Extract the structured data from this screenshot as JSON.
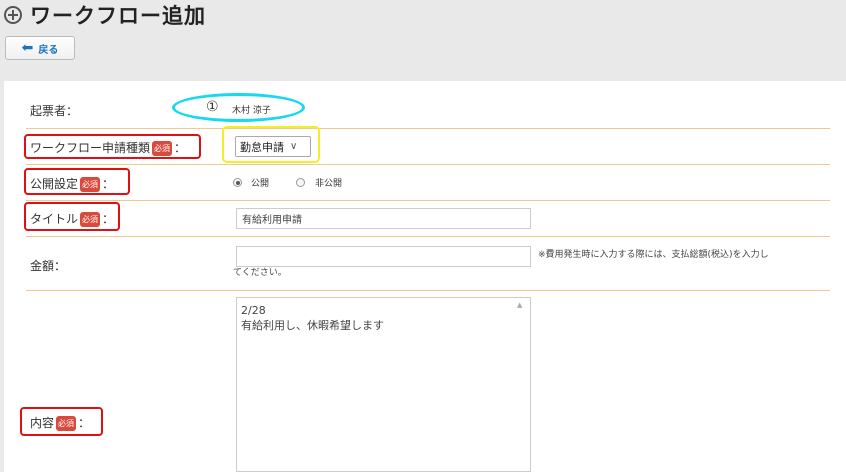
{
  "header": {
    "title": "ワークフロー追加",
    "back_label": "戻る"
  },
  "form": {
    "author": {
      "label": "起票者：",
      "marker": "①",
      "value": "木村 涼子"
    },
    "type": {
      "label": "ワークフロー申請種類",
      "required": "必須",
      "colon": "：",
      "selected": "勤怠申請"
    },
    "visibility": {
      "label": "公開設定",
      "required": "必須",
      "colon": "：",
      "options": [
        "公開",
        "非公開"
      ],
      "selected": "公開"
    },
    "title_field": {
      "label": "タイトル",
      "required": "必須",
      "colon": "：",
      "value": "有給利用申請"
    },
    "amount": {
      "label": "金額：",
      "value": "",
      "note_line1": "※費用発生時に入力する際には、支払総額(税込)を入力し",
      "note_line2": "てください。"
    },
    "content": {
      "label": "内容",
      "required": "必須",
      "colon": "：",
      "value": "2/28\n有給利用し、休暇希望します"
    }
  },
  "colors": {
    "highlight_red": "#dd1111",
    "highlight_cyan": "#16d8f0",
    "highlight_yellow": "#f2ef22",
    "separator": "#f0c98e",
    "required_badge": "#d94a3c",
    "link_blue": "#1e73be"
  }
}
